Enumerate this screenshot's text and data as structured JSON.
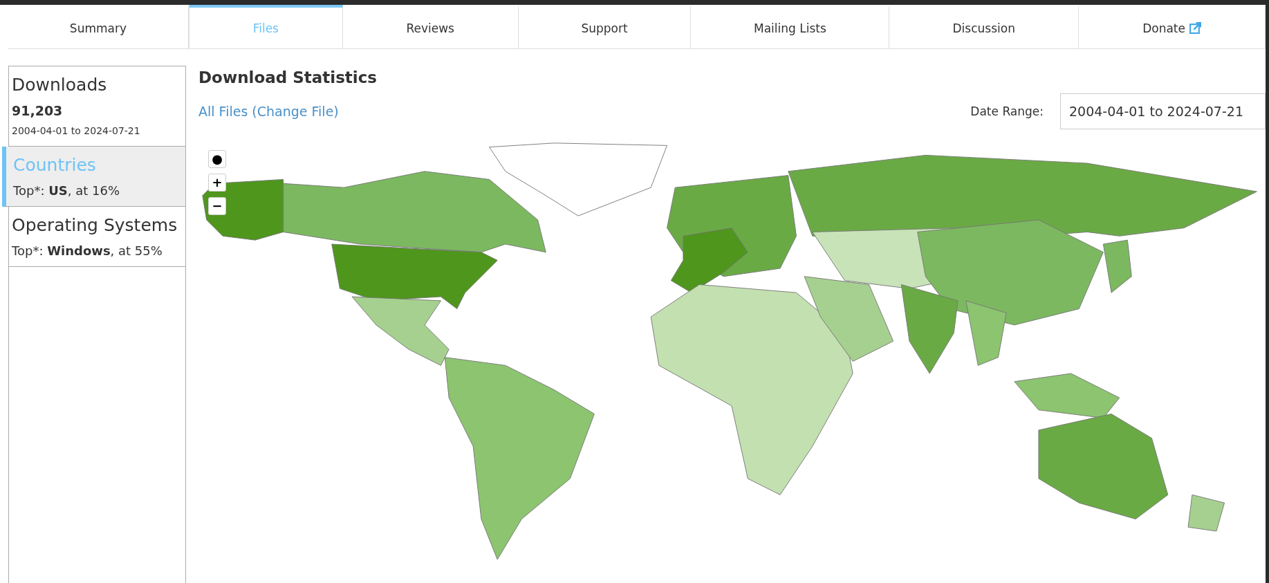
{
  "tabs": [
    {
      "label": "Summary",
      "selected": false,
      "external": false
    },
    {
      "label": "Files",
      "selected": true,
      "external": false
    },
    {
      "label": "Reviews",
      "selected": false,
      "external": false
    },
    {
      "label": "Support",
      "selected": false,
      "external": false
    },
    {
      "label": "Mailing Lists",
      "selected": false,
      "external": false
    },
    {
      "label": "Discussion",
      "selected": false,
      "external": false
    },
    {
      "label": "Donate",
      "selected": false,
      "external": true
    }
  ],
  "sidebar": {
    "downloads": {
      "title": "Downloads",
      "total": "91,203",
      "range": "2004-04-01 to 2024-07-21"
    },
    "items": [
      {
        "title": "Countries",
        "summary": "Top*: **US**, at 16%",
        "selected": true
      },
      {
        "title": "Operating Systems",
        "summary": "Top*: **Windows**, at 55%",
        "selected": false
      }
    ]
  },
  "main": {
    "title": "Download Statistics",
    "file_link": "All Files (Change File)",
    "date_range": {
      "label": "Date Range:",
      "value": "2004-04-01 to 2024-07-21"
    },
    "map": {
      "controls": [
        "●",
        "+",
        "−"
      ]
    }
  }
}
